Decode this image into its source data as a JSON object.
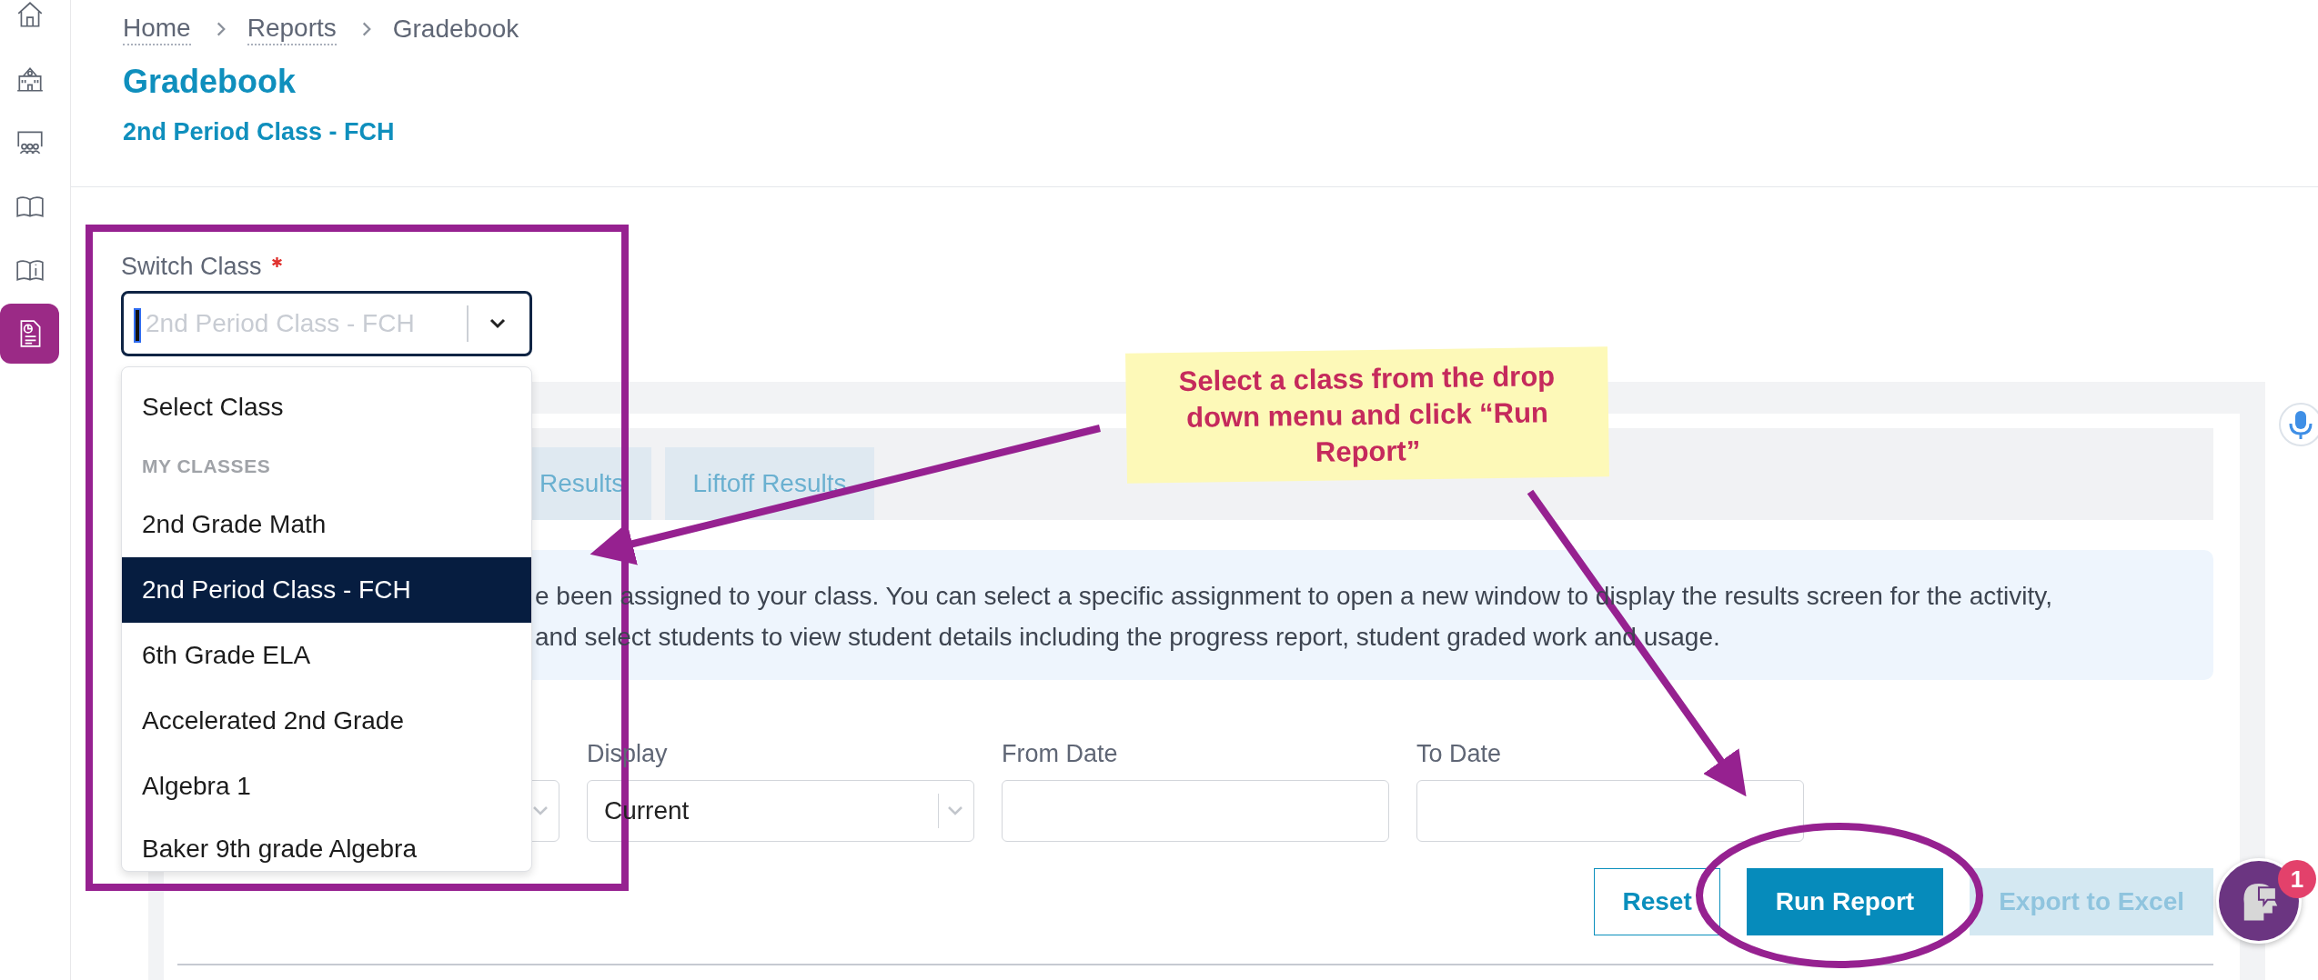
{
  "sidebar": {
    "items": [
      {
        "selected": false
      },
      {
        "selected": false
      },
      {
        "selected": false
      },
      {
        "selected": false
      },
      {
        "selected": false
      },
      {
        "selected": true
      }
    ]
  },
  "breadcrumb": [
    "Home",
    "Reports",
    "Gradebook"
  ],
  "title": "Gradebook",
  "subtitle": "2nd Period Class - FCH",
  "switch_class": {
    "label": "Switch Class",
    "required": true,
    "placeholder": "2nd Period Class - FCH"
  },
  "dropdown": {
    "options": [
      {
        "kind": "option",
        "label": "Select Class",
        "selected": false
      },
      {
        "kind": "group",
        "label": "MY CLASSES",
        "selected": false
      },
      {
        "kind": "option",
        "label": "2nd Grade Math",
        "selected": false
      },
      {
        "kind": "option",
        "label": "2nd Period Class - FCH",
        "selected": true
      },
      {
        "kind": "option",
        "label": "6th Grade ELA",
        "selected": false
      },
      {
        "kind": "option",
        "label": "Accelerated 2nd Grade",
        "selected": false
      },
      {
        "kind": "option",
        "label": "Algebra 1",
        "selected": false
      },
      {
        "kind": "option",
        "label": "Baker 9th grade Algebra",
        "selected": false
      }
    ]
  },
  "tabs": [
    {
      "label": "Results",
      "selected": false
    },
    {
      "label": "Liftoff Results",
      "selected": false
    }
  ],
  "info": {
    "lines": [
      "e been assigned to your class. You can select a specific assignment to open a new window to display the results screen for the activity,",
      "and select students to view student details including the progress report, student graded work and usage."
    ]
  },
  "filters": [
    {
      "kind": "select"
    },
    {
      "kind": "select",
      "label": "Display",
      "value": "Current"
    },
    {
      "kind": "date",
      "label": "From Date"
    },
    {
      "kind": "date",
      "label": "To Date"
    }
  ],
  "buttons": [
    {
      "label": "Reset",
      "kind": "outline",
      "disabled": false
    },
    {
      "label": "Run Report",
      "kind": "primary",
      "disabled": false
    },
    {
      "label": "Export to Excel",
      "kind": "primary",
      "disabled": true
    }
  ],
  "chat": {
    "badge": "1"
  },
  "annotation": {
    "note": "Select a class from the drop down menu and click “Run Report”"
  }
}
